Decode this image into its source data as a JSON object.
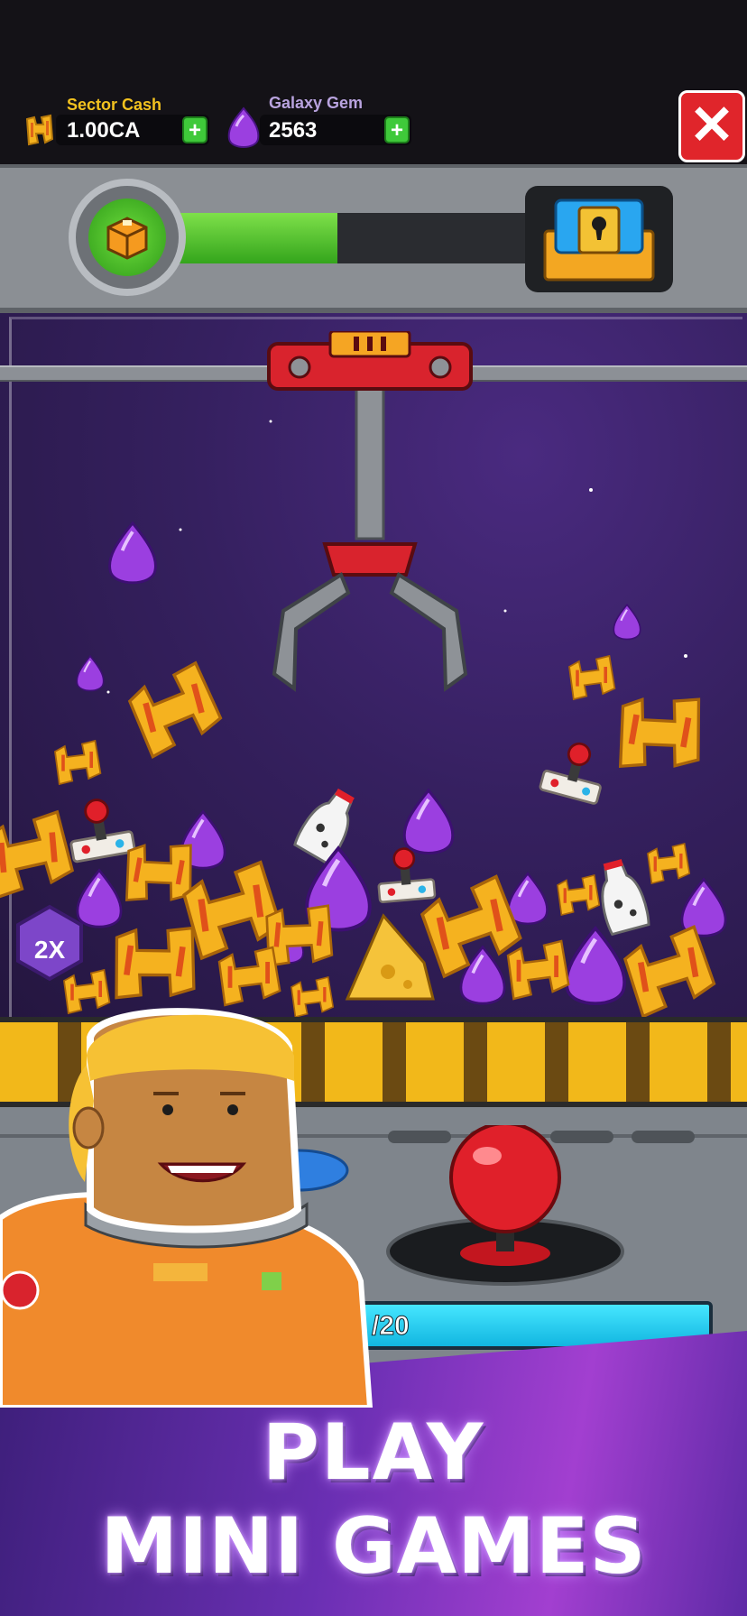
{
  "currencies": {
    "sector_cash": {
      "label": "Sector Cash",
      "value": "1.00CA",
      "plus": "+"
    },
    "galaxy_gem": {
      "label": "Galaxy Gem",
      "value": "2563",
      "plus": "+"
    }
  },
  "close_button": {
    "glyph": "✕"
  },
  "progress": {
    "fraction": 0.45
  },
  "claw_game": {
    "multiplier_label": "2X",
    "pull_counter": "/20"
  },
  "promo": {
    "line1": "PLAY",
    "line2": "MINI GAMES"
  },
  "colors": {
    "sector_cash_label": "#f3c21f",
    "galaxy_gem_label": "#b9a3df",
    "plus_button": "#3fc93a",
    "close_button": "#e0252b",
    "progress_fill": "#4cc12a",
    "gem": "#9b3fe0",
    "bolt": "#f5b21f",
    "joystick": "#e0202a",
    "claw": "#d9232d"
  },
  "icons": {
    "sector_cash": "bolt-coin-icon",
    "galaxy_gem": "purple-gem-icon",
    "crate": "crate-box-icon",
    "chest": "locked-chest-icon",
    "close": "close-x-icon"
  }
}
